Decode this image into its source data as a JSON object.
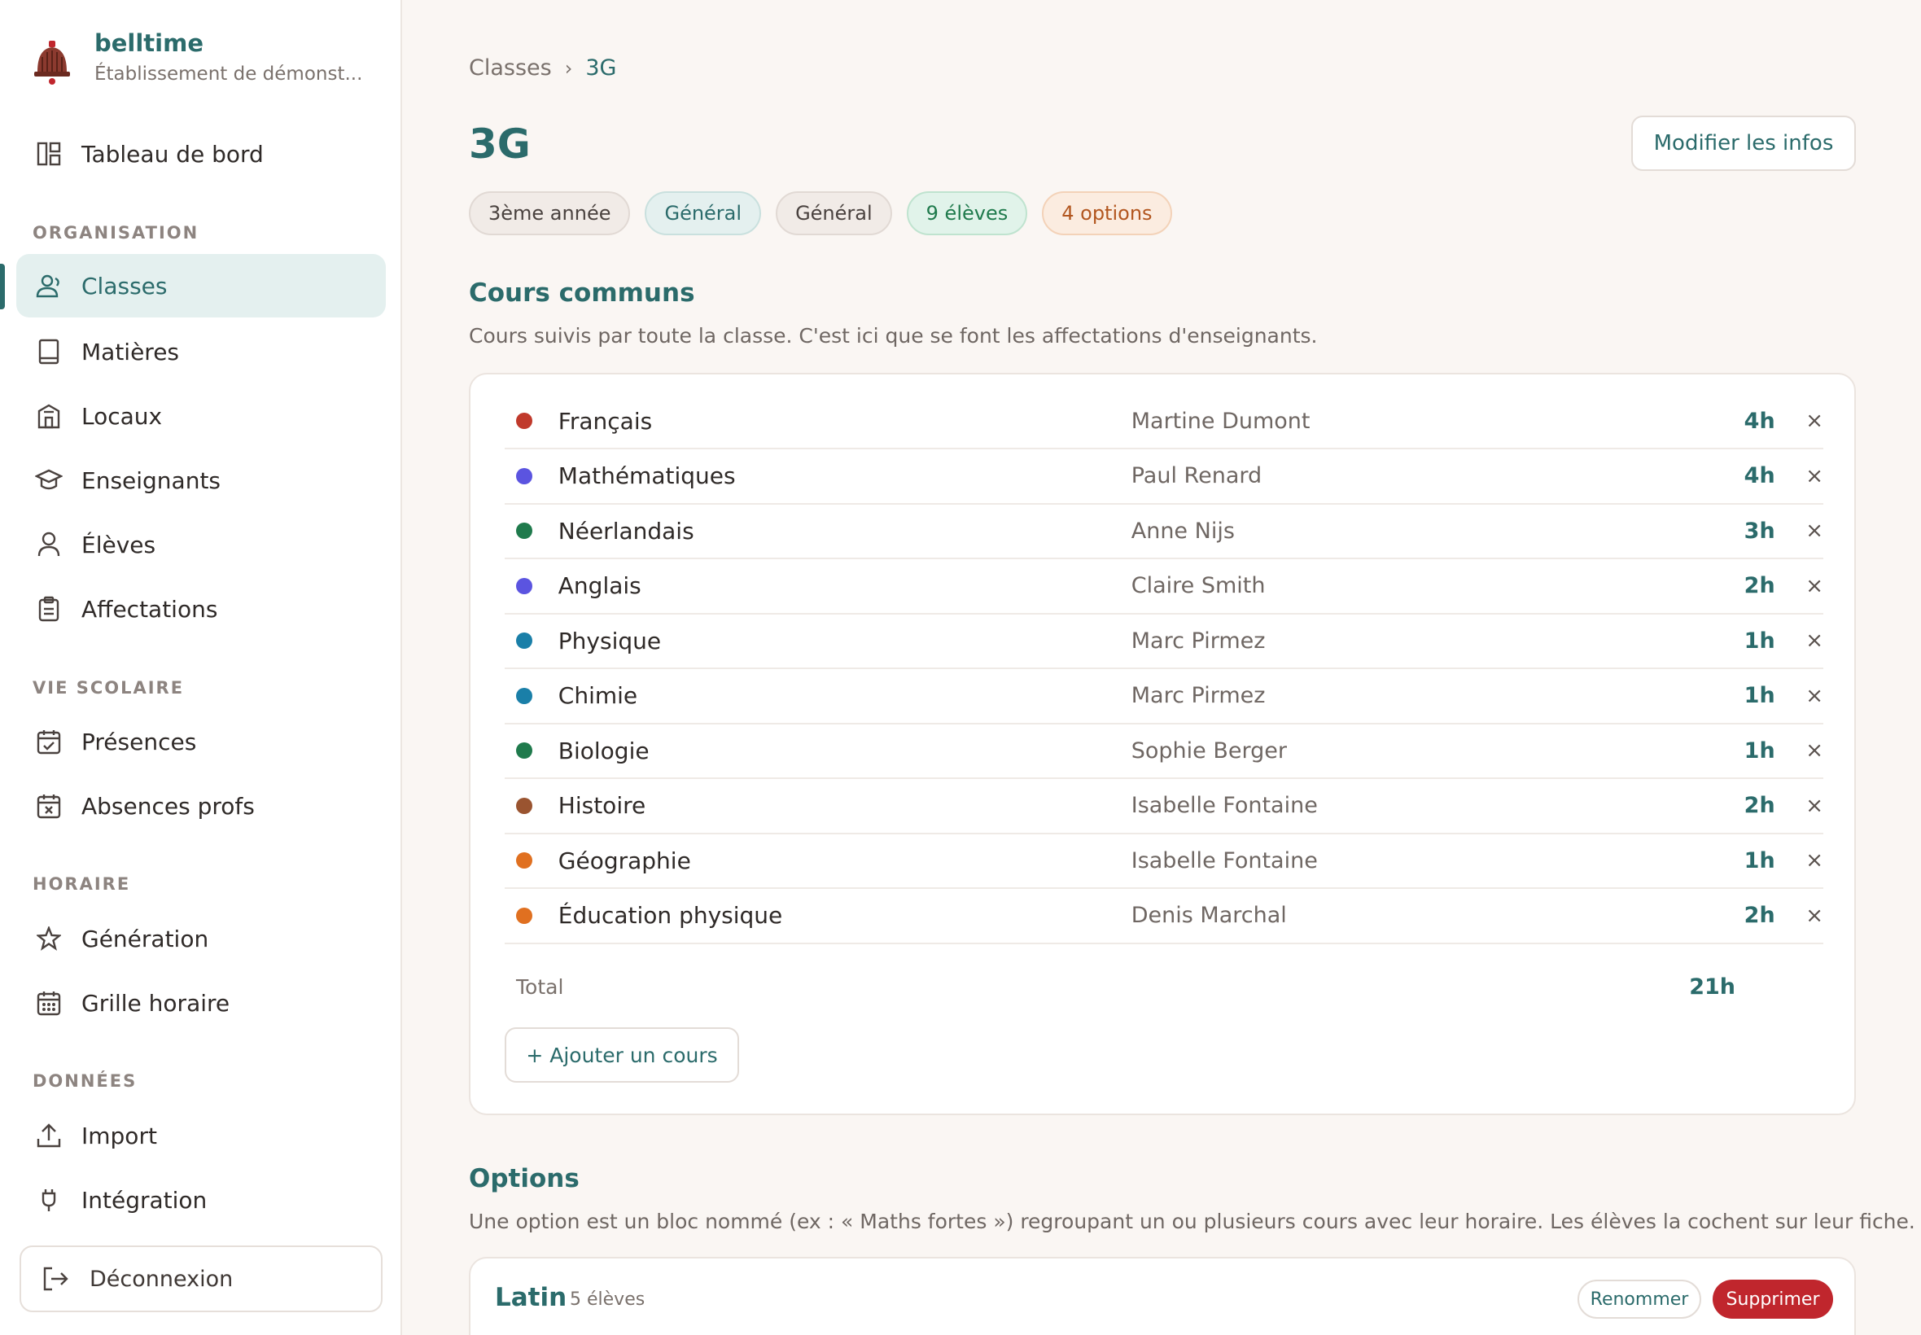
{
  "brand": {
    "name": "belltime",
    "subtitle": "Établissement de démonst..."
  },
  "sidebar": {
    "dashboard": "Tableau de bord",
    "sections": {
      "organisation": "ORGANISATION",
      "vie_scolaire": "VIE SCOLAIRE",
      "horaire": "HORAIRE",
      "donnees": "DONNÉES"
    },
    "items": {
      "classes": "Classes",
      "matieres": "Matières",
      "locaux": "Locaux",
      "enseignants": "Enseignants",
      "eleves": "Élèves",
      "affectations": "Affectations",
      "presences": "Présences",
      "absences": "Absences profs",
      "generation": "Génération",
      "grille": "Grille horaire",
      "import": "Import",
      "integration": "Intégration"
    },
    "logout": "Déconnexion",
    "active_color": "#2b6b6b"
  },
  "breadcrumb": {
    "root": "Classes",
    "separator": "›",
    "current": "3G"
  },
  "page": {
    "title": "3G",
    "edit_button": "Modifier les infos",
    "chips": [
      "3ème année",
      "Général",
      "Général",
      "9 élèves",
      "4 options"
    ]
  },
  "common_courses": {
    "title": "Cours communs",
    "description": "Cours suivis par toute la classe. C'est ici que se font les affectations d'enseignants.",
    "rows": [
      {
        "subject": "Français",
        "teacher": "Martine Dumont",
        "hours": "4h",
        "color": "#c0392b"
      },
      {
        "subject": "Mathématiques",
        "teacher": "Paul Renard",
        "hours": "4h",
        "color": "#5b54e0"
      },
      {
        "subject": "Néerlandais",
        "teacher": "Anne Nijs",
        "hours": "3h",
        "color": "#1f7a4c"
      },
      {
        "subject": "Anglais",
        "teacher": "Claire Smith",
        "hours": "2h",
        "color": "#5b54e0"
      },
      {
        "subject": "Physique",
        "teacher": "Marc Pirmez",
        "hours": "1h",
        "color": "#1a7fa8"
      },
      {
        "subject": "Chimie",
        "teacher": "Marc Pirmez",
        "hours": "1h",
        "color": "#1a7fa8"
      },
      {
        "subject": "Biologie",
        "teacher": "Sophie Berger",
        "hours": "1h",
        "color": "#1f7a4c"
      },
      {
        "subject": "Histoire",
        "teacher": "Isabelle Fontaine",
        "hours": "2h",
        "color": "#9a5430"
      },
      {
        "subject": "Géographie",
        "teacher": "Isabelle Fontaine",
        "hours": "1h",
        "color": "#e07020"
      },
      {
        "subject": "Éducation physique",
        "teacher": "Denis Marchal",
        "hours": "2h",
        "color": "#e07020"
      }
    ],
    "remove_glyph": "×",
    "total_label": "Total",
    "total_value": "21h",
    "add_button": "+ Ajouter un cours"
  },
  "options": {
    "title": "Options",
    "description": "Une option est un bloc nommé (ex : « Maths fortes ») regroupant un ou plusieurs cours avec leur horaire. Les élèves la cochent sur leur fiche.",
    "first": {
      "name": "Latin",
      "count": "5 élèves",
      "rename": "Renommer",
      "delete": "Supprimer"
    }
  }
}
